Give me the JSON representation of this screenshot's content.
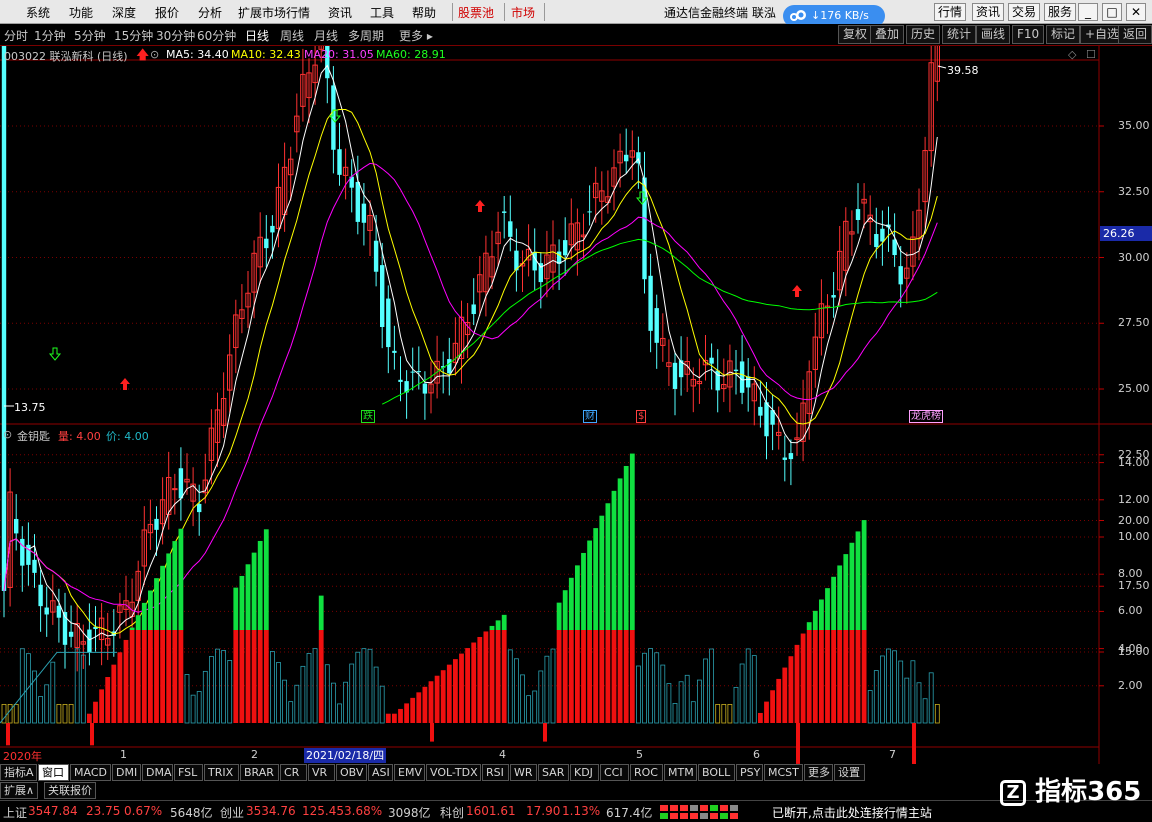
{
  "menu": {
    "items": [
      "系统",
      "功能",
      "深度",
      "报价",
      "分析",
      "扩展市场行情",
      "资讯",
      "工具",
      "帮助"
    ],
    "red_items": [
      "股票池",
      "市场"
    ],
    "app_title": "通达信金融终端 联泓",
    "net_speed": "↓176 KB/s",
    "right_buttons": [
      "行情",
      "资讯",
      "交易",
      "服务"
    ],
    "win_min": "_",
    "win_max": "□",
    "win_close": "✕"
  },
  "toolbar": {
    "timeframes": [
      "分时",
      "1分钟",
      "5分钟",
      "15分钟",
      "30分钟",
      "60分钟",
      "日线",
      "周线",
      "月线",
      "多周期",
      "更多 ▸"
    ],
    "active_timeframe": "日线",
    "right_buttons": [
      "复权",
      "叠加",
      "历史",
      "统计",
      "画线",
      "F10",
      "标记",
      "+自选",
      "返回"
    ]
  },
  "main_chart": {
    "stock_label": "003022 联泓新科 (日线)",
    "ma5": "MA5: 34.40",
    "ma10": "MA10: 32.43",
    "ma20": "MA20: 31.05",
    "ma60": "MA60: 28.91",
    "high_label": "39.58",
    "low_label": "13.75",
    "current_price": "26.26",
    "y_ticks": [
      "35.00",
      "32.50",
      "30.00",
      "27.50",
      "25.00",
      "22.50",
      "20.00",
      "17.50",
      "15.00"
    ],
    "y_values": [
      35,
      32.5,
      30,
      27.5,
      25,
      22.5,
      20,
      17.5,
      15
    ],
    "events": [
      {
        "text": "跌",
        "color": "#1ee01e"
      },
      {
        "text": "财",
        "color": "#3fa8ff"
      },
      {
        "text": "$",
        "color": "#ff4040"
      },
      {
        "text": "龙虎榜",
        "color": "#ffa0ff"
      }
    ],
    "colors": {
      "up": "#ff3232",
      "down": "#54ffff",
      "ma5": "#ffffff",
      "ma10": "#ffff00",
      "ma20": "#ff00ff",
      "ma60": "#00ff00"
    }
  },
  "sub_chart": {
    "indicator_name": "金钥匙",
    "vol_label": "量: 4.00",
    "price_label": "价: 4.00",
    "y_ticks": [
      "14.00",
      "12.00",
      "10.00",
      "8.00",
      "6.00",
      "4.00",
      "2.00"
    ],
    "y_values": [
      14,
      12,
      10,
      8,
      6,
      4,
      2
    ],
    "colors": {
      "red": "#f01010",
      "green": "#10e040",
      "cyan": "#2aa0b0",
      "yellow": "#c8b020"
    }
  },
  "x_axis": {
    "year_label": "2020年",
    "month_labels": [
      "1",
      "2",
      "4",
      "5",
      "6",
      "7"
    ],
    "cursor_date": "2021/02/18/四"
  },
  "tabs": {
    "items": [
      "指标A",
      "窗口",
      "MACD",
      "DMI",
      "DMA",
      "FSL",
      "TRIX",
      "BRAR",
      "CR",
      "VR",
      "OBV",
      "ASI",
      "EMV",
      "VOL-TDX",
      "RSI",
      "WR",
      "SAR",
      "KDJ",
      "CCI",
      "ROC",
      "MTM",
      "BOLL",
      "PSY",
      "MCST",
      "更多",
      "设置"
    ],
    "active": "窗口",
    "sub_items": [
      "扩展∧",
      "关联报价"
    ]
  },
  "status": {
    "sh_label": "上证",
    "sh_value": "3547.84",
    "sh_change": "23.75",
    "sh_pct": "0.67%",
    "sh_amount": "5648亿",
    "cy_label": "创业",
    "cy_value": "3534.76",
    "cy_change": "125.45",
    "cy_pct": "3.68%",
    "cy_amount": "3098亿",
    "kc_label": "科创",
    "kc_value": "1601.61",
    "kc_change": "17.90",
    "kc_pct": "1.13%",
    "kc_amount": "617.4亿",
    "message": "已断开,点击此处连接行情主站",
    "brand": "指标365"
  }
}
